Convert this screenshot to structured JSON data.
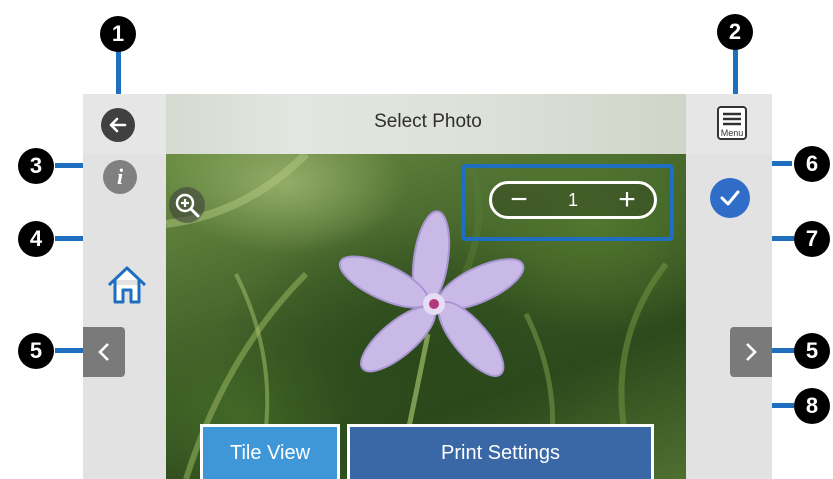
{
  "header": {
    "title": "Select Photo",
    "menu_label": "Menu"
  },
  "stepper": {
    "minus": "−",
    "value": "1",
    "plus": "+"
  },
  "buttons": {
    "tile_view": "Tile View",
    "print_settings": "Print Settings",
    "info": "i"
  },
  "callouts": [
    "1",
    "2",
    "3",
    "4",
    "5",
    "5",
    "6",
    "7",
    "8"
  ],
  "colors": {
    "accent_line": "#1f6fc1",
    "check": "#2f6dc9",
    "tile": "#3f97d8",
    "print": "#3a67a6",
    "panel": "#e2e2e2"
  }
}
